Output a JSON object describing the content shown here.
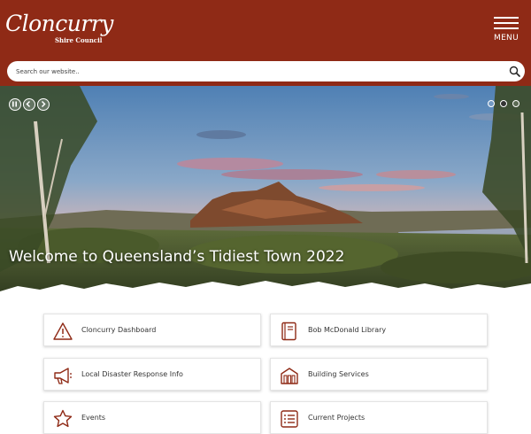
{
  "header": {
    "logo_script": "Cloncurry",
    "logo_sub": "Shire Council",
    "menu_label": "MENU",
    "background": "#8f2a16"
  },
  "search": {
    "placeholder": "Search our website..",
    "icon": "search-icon"
  },
  "hero": {
    "title": "Welcome to Queensland’s Tidiest Town 2022",
    "controls": [
      "pause-icon",
      "chevron-left-icon",
      "chevron-right-icon"
    ],
    "slide_count": 3,
    "active_slide": 2
  },
  "tiles": [
    {
      "label": "Cloncurry Dashboard",
      "icon": "warning-triangle-icon"
    },
    {
      "label": "Bob McDonald Library",
      "icon": "book-icon"
    },
    {
      "label": "Local Disaster Response Info",
      "icon": "megaphone-icon"
    },
    {
      "label": "Building Services",
      "icon": "building-icon"
    },
    {
      "label": "Events",
      "icon": "star-icon"
    },
    {
      "label": "Current Projects",
      "icon": "list-icon"
    }
  ],
  "colors": {
    "brand": "#8f2a16",
    "icon": "#8f2a16"
  }
}
